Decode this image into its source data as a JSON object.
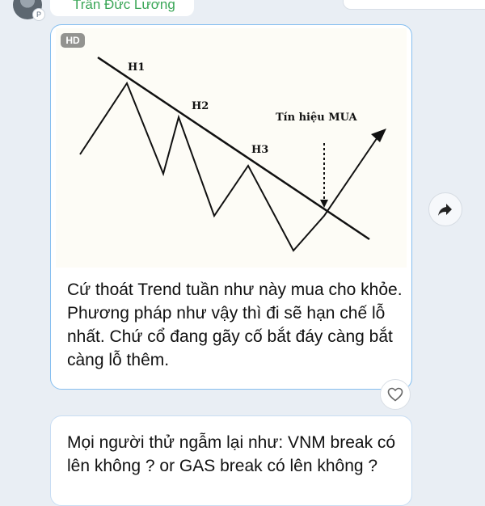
{
  "sender": {
    "name": "Trần Đức Lương"
  },
  "message1": {
    "hd_badge": "HD",
    "text": "Cứ thoát Trend tuần như này mua cho khỏe. Phương pháp như vậy thì đi sẽ hạn chế lỗ nhất. Chứ cổ đang gãy cố bắt đáy càng bắt càng lỗ thêm."
  },
  "message2": {
    "text": "Mọi người thử ngẫm lại như: VNM break có lên không ? or GAS break có lên không ?"
  },
  "chart_image": {
    "peak_labels": [
      "H1",
      "H2",
      "H3"
    ],
    "signal_label": "Tín hiệu MUA"
  },
  "icons": {
    "forward": "forward-arrow-icon",
    "heart": "heart-icon",
    "avatar_badge": "profile-badge-icon"
  },
  "colors": {
    "sender_name": "#3aa657",
    "card_border": "#86bff0",
    "background": "#e9eef4"
  }
}
